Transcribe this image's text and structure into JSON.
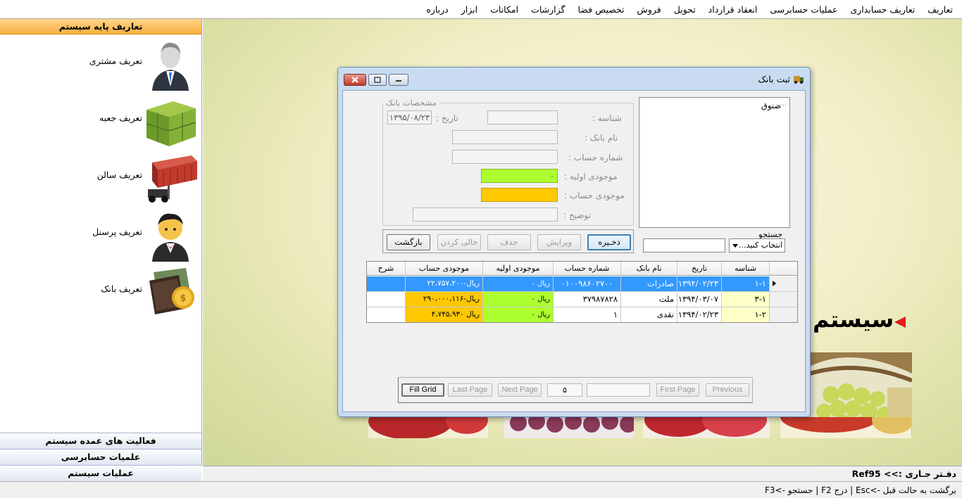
{
  "menu": [
    "تعاریف",
    "تعاریف حسابداری",
    "عملیات حسابرسی",
    "انعقاد قرارداد",
    "تحویل",
    "فروش",
    "تخصیص فضا",
    "گزارشات",
    "امکانات",
    "ابزار",
    "درباره"
  ],
  "sidebar": {
    "header": "تعاریف پایه سیستم",
    "items": [
      {
        "label": "تعریف مشتری",
        "icon": "business-man-icon"
      },
      {
        "label": "تعریف جعبه",
        "icon": "crates-icon"
      },
      {
        "label": "تعریف سالن",
        "icon": "container-forklift-icon"
      },
      {
        "label": "تعریف پرسنل",
        "icon": "staff-person-icon"
      },
      {
        "label": "تعریف بانک",
        "icon": "wallet-coin-icon"
      }
    ],
    "groups": [
      "فعالیت های عمده سیستم",
      "علمیات حسابرسی",
      "عملیات سیستم"
    ]
  },
  "desktop": {
    "title": "سیستم"
  },
  "window": {
    "title": "ثبت بانک",
    "fieldset_legend": "مشخصات بانک",
    "fields": {
      "id_label": "شناسه :",
      "date_label": "تاریخ :",
      "date_value": "۱۳۹۵/۰۸/۲۳",
      "bank_name_label": "نام بانک :",
      "account_no_label": "شماره حساب :",
      "initial_balance_label": "موجودی اولیه :",
      "initial_balance_value": "۰",
      "account_balance_label": "موجودی حساب :",
      "description_label": "توضیح :"
    },
    "tree": {
      "node": "صنوق",
      "dots": "....."
    },
    "search": {
      "label": "جستجو",
      "combo_value": "انتخاب کنید...",
      "text": ""
    },
    "actions": {
      "save": "ذخـیره",
      "edit": "ویرایش",
      "delete": "حذف",
      "clear": "خالی کردن",
      "back": "بازگشت"
    },
    "grid": {
      "columns": [
        "شناسه",
        "تاریخ",
        "نام بانک",
        "شماره حساب",
        "موجودی اولیه",
        "موجودی حساب",
        "شرح"
      ],
      "rows": [
        {
          "id": "۱-۱",
          "date": "۱۳۹۴/۰۲/۲۳",
          "bank": "صادرات",
          "account": "۰۱۰۰۹۸۶۰۲۷۰۰",
          "initial": "ریال ۰",
          "balance": "ریال-۲۲،۷۵۷،۲۰۰",
          "desc": ""
        },
        {
          "id": "۳-۱",
          "date": "۱۳۹۴/۰۳/۰۷",
          "bank": "ملت",
          "account": "۳۷۹۸۷۸۲۸",
          "initial": "ریال ۰",
          "balance": "ریال-۲۹۰،۰۰۰،۱۱۶",
          "desc": ""
        },
        {
          "id": "۱-۲",
          "date": "۱۳۹۴/۰۲/۲۳",
          "bank": "نقدی",
          "account": "۱",
          "initial": "ریال ۰",
          "balance": "ریال ۴،۷۴۵،۹۳۰",
          "desc": ""
        }
      ]
    },
    "pager": {
      "fill_grid": "Fill Grid",
      "last": "Last Page",
      "next": "Next Page",
      "page_size": "۵",
      "page_info": "",
      "first": "First Page",
      "previous": "Previous"
    }
  },
  "status": {
    "ledger": "دفـتر جـاری :>> Ref95",
    "hints": "برگشت به حالت قبل ->Esc | درج F2 | جستجو ->F3"
  }
}
